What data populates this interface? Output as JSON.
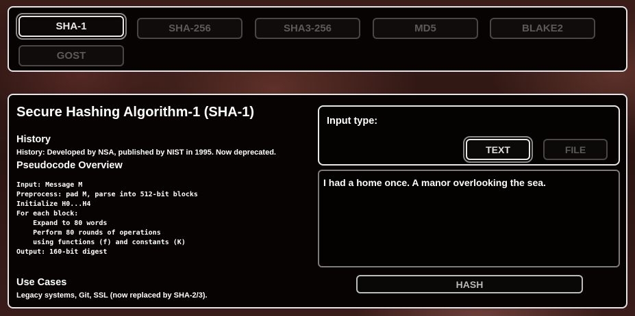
{
  "algorithms": [
    {
      "label": "SHA-1",
      "active": true
    },
    {
      "label": "SHA-256",
      "active": false
    },
    {
      "label": "SHA3-256",
      "active": false
    },
    {
      "label": "MD5",
      "active": false
    },
    {
      "label": "BLAKE2",
      "active": false
    },
    {
      "label": "GOST",
      "active": false
    }
  ],
  "info": {
    "title": "Secure Hashing Algorithm-1 (SHA-1)",
    "history_heading": "History",
    "history_text": "History: Developed by NSA, published by NIST in 1995. Now deprecated.",
    "pseudocode_heading": "Pseudocode Overview",
    "pseudocode": "Input: Message M\nPreprocess: pad M, parse into 512-bit blocks\nInitialize H0...H4\nFor each block:\n    Expand to 80 words\n    Perform 80 rounds of operations\n    using functions (f) and constants (K)\nOutput: 160-bit digest",
    "use_cases_heading": "Use Cases",
    "use_cases_text": "Legacy systems, Git, SSL (now replaced by SHA-2/3)."
  },
  "input": {
    "type_label": "Input type:",
    "text_button": "TEXT",
    "file_button": "FILE",
    "selected_type": "TEXT",
    "text_value": "I had a home once. A manor overlooking the sea."
  },
  "hash_button": "HASH",
  "colors": {
    "panel_bg": "#070303",
    "panel_border": "#e6e6e6",
    "inactive_text": "#5c5959"
  }
}
